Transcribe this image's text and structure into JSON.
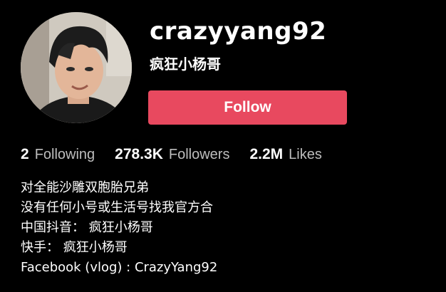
{
  "profile": {
    "username": "crazyyang92",
    "nickname": "疯狂小杨哥",
    "follow_label": "Follow",
    "avatar_icon": "avatar-photo",
    "accent_color": "#e8495f"
  },
  "stats": [
    {
      "value": "2",
      "label": "Following"
    },
    {
      "value": "278.3K",
      "label": "Followers"
    },
    {
      "value": "2.2M",
      "label": "Likes"
    }
  ],
  "bio": [
    "对全能沙雕双胞胎兄弟",
    "没有任何小号或生活号找我官方合",
    "中国抖音： 疯狂小杨哥",
    "快手： 疯狂小杨哥",
    "Facebook (vlog) : CrazyYang92"
  ]
}
